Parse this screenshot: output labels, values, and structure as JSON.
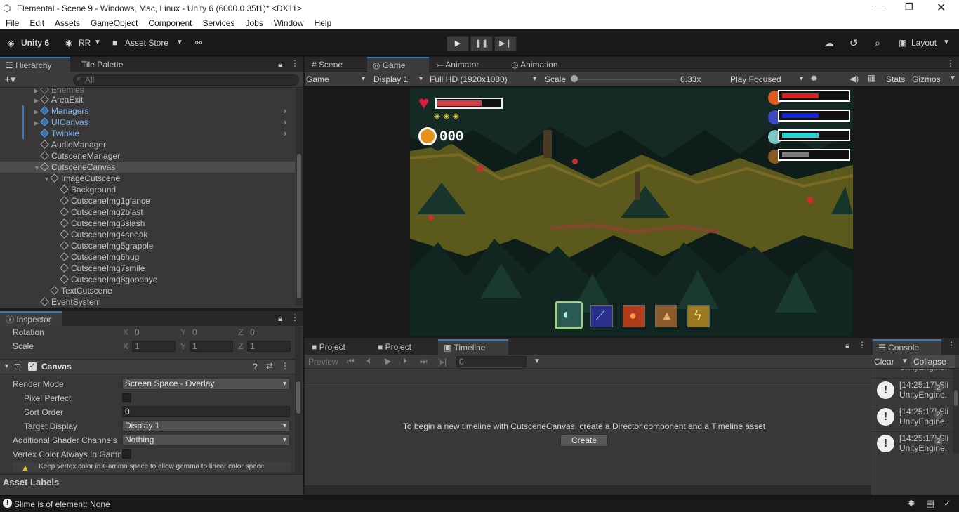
{
  "window": {
    "title": "Elemental - Scene 9 - Windows, Mac, Linux - Unity 6 (6000.0.35f1)* <DX11>"
  },
  "menu": [
    "File",
    "Edit",
    "Assets",
    "GameObject",
    "Component",
    "Services",
    "Jobs",
    "Window",
    "Help"
  ],
  "toolbar": {
    "unity_label": "Unity 6",
    "account": "RR",
    "asset_store": "Asset Store",
    "layout": "Layout"
  },
  "hierarchy": {
    "tab": "Hierarchy",
    "tab2": "Tile Palette",
    "search_placeholder": "All",
    "items": [
      {
        "label": "Enemies"
      },
      {
        "label": "AreaExit"
      },
      {
        "label": "Managers"
      },
      {
        "label": "UICanvas"
      },
      {
        "label": "Twinkle"
      },
      {
        "label": "AudioManager"
      },
      {
        "label": "CutsceneManager"
      },
      {
        "label": "CutsceneCanvas"
      },
      {
        "label": "ImageCutscene"
      },
      {
        "label": "Background"
      },
      {
        "label": "CutsceneImg1glance"
      },
      {
        "label": "CutsceneImg2blast"
      },
      {
        "label": "CutsceneImg3slash"
      },
      {
        "label": "CutsceneImg4sneak"
      },
      {
        "label": "CutsceneImg5grapple"
      },
      {
        "label": "CutsceneImg6hug"
      },
      {
        "label": "CutsceneImg7smile"
      },
      {
        "label": "CutsceneImg8goodbye"
      },
      {
        "label": "TextCutscene"
      },
      {
        "label": "EventSystem"
      }
    ]
  },
  "game_view": {
    "tabs": [
      "Scene",
      "Game",
      "Animator",
      "Animation"
    ],
    "mode": "Game",
    "display": "Display 1",
    "resolution": "Full HD (1920x1080)",
    "scale_label": "Scale",
    "scale_value": "0.33x",
    "play_focused": "Play Focused",
    "stats": "Stats",
    "gizmos": "Gizmos",
    "hud": {
      "coins": "000",
      "health": 0.7,
      "bars": [
        0.55,
        0.55,
        0.55,
        0.4
      ]
    }
  },
  "inspector": {
    "tab": "Inspector",
    "rotation": {
      "label": "Rotation",
      "x": "0",
      "y": "0",
      "z": "0"
    },
    "scale": {
      "label": "Scale",
      "x": "1",
      "y": "1",
      "z": "1"
    },
    "component": "Canvas",
    "render_mode": {
      "label": "Render Mode",
      "value": "Screen Space - Overlay"
    },
    "pixel_perfect": "Pixel Perfect",
    "sort_order": {
      "label": "Sort Order",
      "value": "0"
    },
    "target_display": {
      "label": "Target Display",
      "value": "Display 1"
    },
    "shader_channels": {
      "label": "Additional Shader Channels",
      "value": "Nothing"
    },
    "vertex_color": "Vertex Color Always In Gamma",
    "warning": "Keep vertex color in Gamma space to allow gamma to linear color space",
    "asset_labels": "Asset Labels"
  },
  "bottom_tabs": {
    "project1": "Project",
    "project2": "Project",
    "timeline": "Timeline"
  },
  "timeline": {
    "preview": "Preview",
    "frame": "0",
    "message": "To begin a new timeline with CutsceneCanvas, create a Director component and a Timeline asset",
    "create": "Create"
  },
  "console": {
    "tab": "Console",
    "clear": "Clear",
    "collapse": "Collapse",
    "entries": [
      {
        "time": "[14:25:17] Sli",
        "src": "UnityEngine.",
        "count": "2"
      },
      {
        "time": "[14:25:17] Sli",
        "src": "UnityEngine.",
        "count": "2"
      },
      {
        "time": "[14:25:17] Sli",
        "src": "UnityEngine.",
        "count": "2"
      }
    ]
  },
  "status": {
    "message": "Slime is of element: None"
  }
}
